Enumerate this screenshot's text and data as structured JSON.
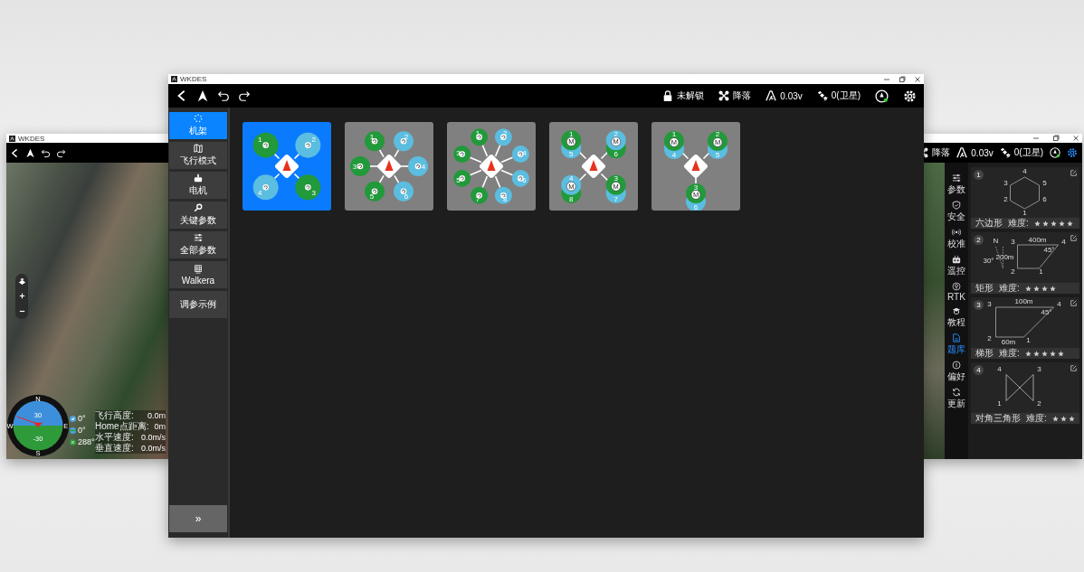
{
  "left_window": {
    "title": "WKDES",
    "attitude": {
      "heading_labels": [
        "N",
        "E",
        "S",
        "W"
      ],
      "pitch_labels": [
        "30",
        "-30"
      ]
    },
    "telemetry_icons": [
      {
        "kind": "plane",
        "value": "0°"
      },
      {
        "kind": "globe",
        "value": "0°"
      },
      {
        "kind": "heading",
        "value": "288°"
      }
    ],
    "telemetry": [
      {
        "label": "飞行高度:",
        "value": "0.0m"
      },
      {
        "label": "Home点距离:",
        "value": "0m"
      },
      {
        "label": "水平速度:",
        "value": "0.0m/s"
      },
      {
        "label": "垂直速度:",
        "value": "0.0m/s"
      }
    ]
  },
  "right_window": {
    "toolbar": {
      "status": [
        {
          "kind": "drone",
          "label": "降落"
        },
        {
          "kind": "voltage",
          "label": "0.03v"
        },
        {
          "kind": "satellite",
          "label": "0(卫星)"
        }
      ]
    },
    "sidebar": {
      "items": [
        {
          "kind": "params",
          "label": "参数",
          "selected": false
        },
        {
          "kind": "safety",
          "label": "安全",
          "selected": false
        },
        {
          "kind": "calibrate",
          "label": "校准",
          "selected": false
        },
        {
          "kind": "remote",
          "label": "遥控",
          "selected": false
        },
        {
          "kind": "rtk",
          "label": "RTK",
          "selected": false
        },
        {
          "kind": "tutorial",
          "label": "教程",
          "selected": false
        },
        {
          "kind": "library",
          "label": "题库",
          "selected": true
        },
        {
          "kind": "preference",
          "label": "偏好",
          "selected": false
        },
        {
          "kind": "update",
          "label": "更新",
          "selected": false
        }
      ]
    },
    "exercises": [
      {
        "number": "1",
        "kind": "hexagon",
        "labels": [
          "4",
          "3",
          "5",
          "2",
          "6",
          "1"
        ],
        "name": "六边形",
        "difficulty_label": "难度:",
        "stars": 5
      },
      {
        "number": "2",
        "kind": "rectangle",
        "labels": [
          "N",
          "30°",
          "3",
          "400m",
          "4",
          "45°",
          "200m",
          "2",
          "1"
        ],
        "name": "矩形",
        "difficulty_label": "难度:",
        "stars": 4
      },
      {
        "number": "3",
        "kind": "trapezoid",
        "labels": [
          "3",
          "100m",
          "4",
          "45°",
          "2",
          "60m",
          "1"
        ],
        "name": "梯形",
        "difficulty_label": "难度:",
        "stars": 5
      },
      {
        "number": "4",
        "kind": "bowtie",
        "labels": [
          "4",
          "3",
          "1",
          "2"
        ],
        "name": "对角三角形",
        "difficulty_label": "难度:",
        "stars": 3
      }
    ]
  },
  "main_window": {
    "title": "WKDES",
    "toolbar": {
      "status": [
        {
          "kind": "lock",
          "label": "未解锁"
        },
        {
          "kind": "drone",
          "label": "降落"
        },
        {
          "kind": "voltage",
          "label": "0.03v"
        },
        {
          "kind": "satellite",
          "label": "0(卫星)"
        }
      ]
    },
    "sidebar": {
      "items": [
        {
          "kind": "frame",
          "label": "机架",
          "selected": true
        },
        {
          "kind": "flight_mode",
          "label": "飞行模式",
          "selected": false
        },
        {
          "kind": "motor",
          "label": "电机",
          "selected": false
        },
        {
          "kind": "key_params",
          "label": "关键参数",
          "selected": false
        },
        {
          "kind": "all_params",
          "label": "全部参数",
          "selected": false
        },
        {
          "kind": "walkera",
          "label": "Walkera",
          "selected": false
        },
        {
          "kind": "tuning",
          "label": "调参示例",
          "selected": false
        }
      ],
      "expand_button": "»"
    },
    "frames": [
      {
        "kind": "quad_x",
        "selected": true,
        "arms": [
          {
            "motors": [
              {
                "label": "1",
                "color": "#22993a"
              }
            ]
          },
          {
            "motors": [
              {
                "label": "2",
                "color": "#5bbde0"
              }
            ]
          },
          {
            "motors": [
              {
                "label": "4",
                "color": "#5bbde0"
              }
            ]
          },
          {
            "motors": [
              {
                "label": "3",
                "color": "#22993a"
              }
            ]
          }
        ]
      },
      {
        "kind": "hex",
        "selected": false,
        "arms": [
          {
            "motors": [
              {
                "label": "1",
                "color": "#22993a"
              }
            ]
          },
          {
            "motors": [
              {
                "label": "2",
                "color": "#5bbde0"
              }
            ]
          },
          {
            "motors": [
              {
                "label": "3",
                "color": "#22993a"
              }
            ]
          },
          {
            "motors": [
              {
                "label": "4",
                "color": "#5bbde0"
              }
            ]
          },
          {
            "motors": [
              {
                "label": "5",
                "color": "#22993a"
              }
            ]
          },
          {
            "motors": [
              {
                "label": "6",
                "color": "#5bbde0"
              }
            ]
          }
        ]
      },
      {
        "kind": "octo",
        "selected": false,
        "arms": [
          {
            "motors": [
              {
                "label": "1",
                "color": "#22993a"
              }
            ]
          },
          {
            "motors": [
              {
                "label": "2",
                "color": "#5bbde0"
              }
            ]
          },
          {
            "motors": [
              {
                "label": "3",
                "color": "#22993a"
              }
            ]
          },
          {
            "motors": [
              {
                "label": "4",
                "color": "#5bbde0"
              }
            ]
          },
          {
            "motors": [
              {
                "label": "5",
                "color": "#22993a"
              }
            ]
          },
          {
            "motors": [
              {
                "label": "6",
                "color": "#5bbde0"
              }
            ]
          },
          {
            "motors": [
              {
                "label": "7",
                "color": "#22993a"
              }
            ]
          },
          {
            "motors": [
              {
                "label": "8",
                "color": "#5bbde0"
              }
            ]
          }
        ]
      },
      {
        "kind": "x8",
        "selected": false,
        "arms": [
          {
            "motors": [
              {
                "label": "1",
                "color": "#22993a",
                "badge": "M"
              },
              {
                "label": "5",
                "color": "#5bbde0"
              }
            ]
          },
          {
            "motors": [
              {
                "label": "2",
                "color": "#5bbde0",
                "badge": "M"
              },
              {
                "label": "6",
                "color": "#22993a"
              }
            ]
          },
          {
            "motors": [
              {
                "label": "4",
                "color": "#5bbde0",
                "badge": "M"
              },
              {
                "label": "8",
                "color": "#22993a"
              }
            ]
          },
          {
            "motors": [
              {
                "label": "3",
                "color": "#22993a",
                "badge": "M"
              },
              {
                "label": "7",
                "color": "#5bbde0"
              }
            ]
          }
        ]
      },
      {
        "kind": "y6",
        "selected": false,
        "arms": [
          {
            "motors": [
              {
                "label": "1",
                "color": "#22993a",
                "badge": "M"
              },
              {
                "label": "4",
                "color": "#5bbde0"
              }
            ]
          },
          {
            "motors": [
              {
                "label": "2",
                "color": "#22993a",
                "badge": "M"
              },
              {
                "label": "5",
                "color": "#5bbde0"
              }
            ]
          },
          {
            "motors": [
              {
                "label": "3",
                "color": "#22993a",
                "badge": "M"
              },
              {
                "label": "6",
                "color": "#5bbde0"
              }
            ]
          }
        ]
      }
    ]
  }
}
